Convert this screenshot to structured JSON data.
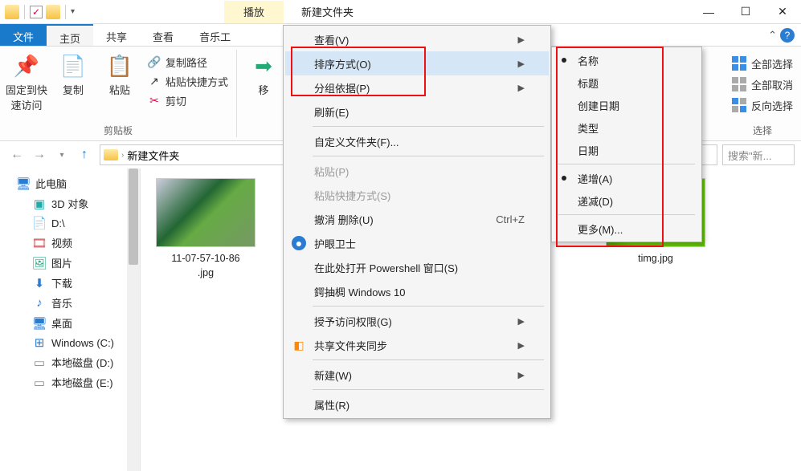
{
  "title": "新建文件夹",
  "tab_extra": "播放",
  "tabs": {
    "file": "文件",
    "home": "主页",
    "share": "共享",
    "view": "查看",
    "music": "音乐工"
  },
  "ribbon": {
    "pin": "固定到快\n速访问",
    "copy": "复制",
    "paste": "粘贴",
    "copy_path": "复制路径",
    "paste_shortcut": "粘贴快捷方式",
    "cut": "剪切",
    "clipboard_group": "剪贴板",
    "move": "移",
    "select_all": "全部选择",
    "select_none": "全部取消",
    "invert_sel": "反向选择",
    "select_group": "选择"
  },
  "breadcrumb": "新建文件夹",
  "search_placeholder": "搜索\"新...",
  "tree": {
    "this_pc": "此电脑",
    "obj3d": "3D 对象",
    "d_drive": "D:\\",
    "videos": "视频",
    "pictures": "图片",
    "downloads": "下载",
    "music": "音乐",
    "desktop": "桌面",
    "win_c": "Windows (C:)",
    "disk_d": "本地磁盘 (D:)",
    "disk_e": "本地磁盘 (E:)"
  },
  "files": {
    "f1": "11-07-57-10-86\n.jpg",
    "f2": "timg.jpg"
  },
  "ctx": {
    "view": "查看(V)",
    "sort": "排序方式(O)",
    "group": "分组依据(P)",
    "refresh": "刷新(E)",
    "custom": "自定义文件夹(F)...",
    "paste": "粘贴(P)",
    "paste_short": "粘贴快捷方式(S)",
    "undo": "撤消 删除(U)",
    "undo_key": "Ctrl+Z",
    "eye": "护眼卫士",
    "powershell": "在此处打开 Powershell 窗口(S)",
    "win10": "鍔抽椆 Windows 10",
    "perm": "授予访问权限(G)",
    "sync": "共享文件夹同步",
    "new": "新建(W)",
    "prop": "属性(R)"
  },
  "submenu": {
    "name": "名称",
    "title_s": "标题",
    "created": "创建日期",
    "type": "类型",
    "date": "日期",
    "asc": "递增(A)",
    "desc": "递减(D)",
    "more": "更多(M)..."
  }
}
